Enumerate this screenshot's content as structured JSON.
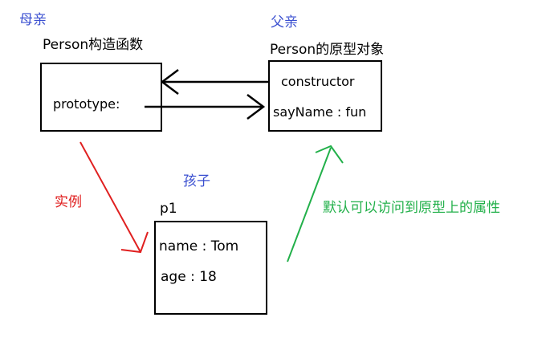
{
  "roles": {
    "mother": "母亲",
    "father": "父亲",
    "child": "孩子"
  },
  "constructor_box": {
    "title": "Person构造函数",
    "prototype_label": "prototype:"
  },
  "prototype_box": {
    "title": "Person的原型对象",
    "constructor_label": "constructor",
    "say_name_label": "sayName : fun"
  },
  "instance_box": {
    "title": "p1",
    "name_label": "name :  Tom",
    "age_label": "age  :  18"
  },
  "arrows": {
    "instance_label": "实例",
    "access_label": "默认可以访问到原型上的属性"
  },
  "colors": {
    "role_label": "#3a4fd0",
    "instance_arrow": "#e02020",
    "access_arrow": "#22b04a",
    "line": "#000000"
  }
}
